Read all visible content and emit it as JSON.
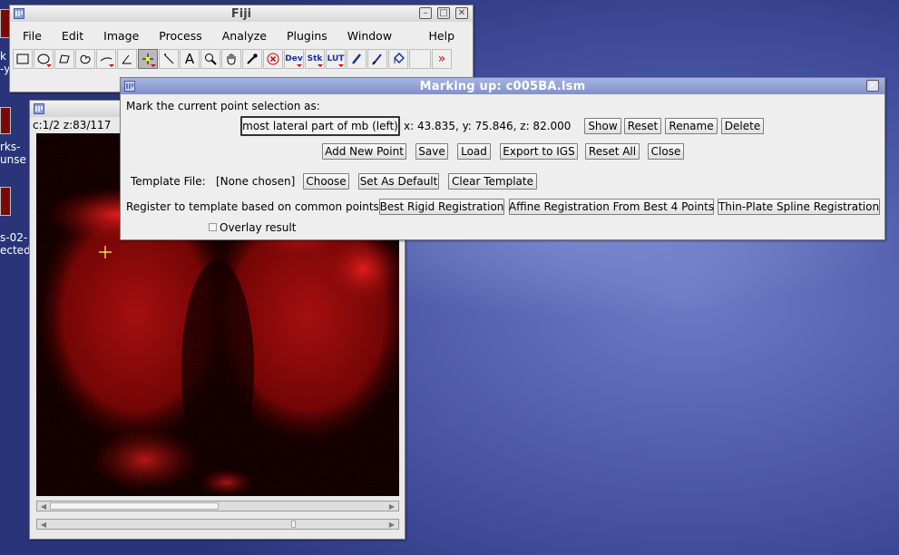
{
  "desktop": {
    "labels": [
      "rks-",
      "unse",
      "s-02-",
      "ected"
    ],
    "fragments": [
      "k",
      "-y"
    ]
  },
  "fiji": {
    "title": "Fiji",
    "menus": [
      "File",
      "Edit",
      "Image",
      "Process",
      "Analyze",
      "Plugins",
      "Window",
      "Help"
    ],
    "tools": [
      "rectangle-tool",
      "oval-tool",
      "polygon-tool",
      "freehand-tool",
      "line-tool",
      "angle-tool",
      "point-tool",
      "wand-tool",
      "text-tool",
      "magnifier-tool",
      "hand-tool",
      "dropper-tool",
      "close-x-tool",
      "dev-tool",
      "stk-tool",
      "lut-tool",
      "pencil-tool",
      "brush-tool",
      "flood-fill-tool",
      "empty-tool",
      "more-tools"
    ],
    "tool_text": {
      "text": "A",
      "dev": "Dev",
      "stk": "Stk",
      "lut": "LUT",
      "more": "»"
    }
  },
  "image_window": {
    "info": "c:1/2 z:83/117"
  },
  "dialog": {
    "title": "Marking up: c005BA.lsm",
    "mark_label": "Mark the current point selection as:",
    "point_name": "most lateral part of mb (left)",
    "coords": "x: 43.835, y: 75.846, z: 82.000",
    "show": "Show",
    "reset": "Reset",
    "rename": "Rename",
    "delete": "Delete",
    "add_new_point": "Add New Point",
    "save": "Save",
    "load": "Load",
    "export_igs": "Export to IGS",
    "reset_all": "Reset All",
    "close": "Close",
    "template_file_label": "Template File:",
    "template_file_value": "[None chosen]",
    "choose": "Choose",
    "set_as_default": "Set As Default",
    "clear_template": "Clear Template",
    "register_label": "Register to template based on common points:",
    "best_rigid": "Best Rigid Registration",
    "affine": "Affine Registration From Best 4 Points",
    "thin_plate": "Thin-Plate Spline Registration",
    "overlay_label": "Overlay result",
    "overlay_checked": false
  }
}
